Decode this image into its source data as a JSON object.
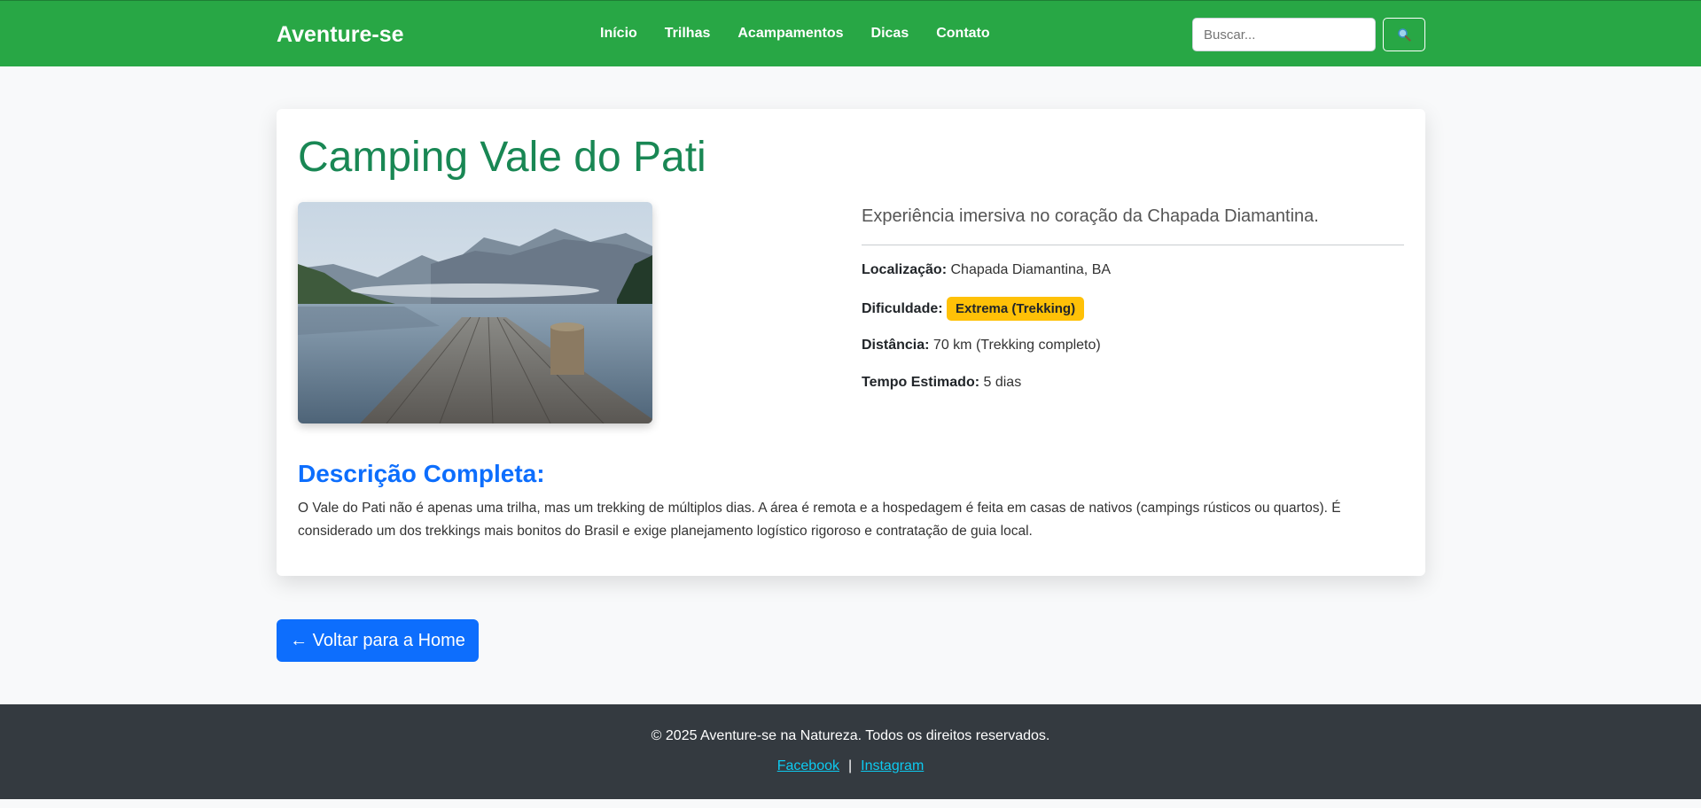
{
  "header": {
    "brand": "Aventure-se",
    "nav": [
      "Início",
      "Trilhas",
      "Acampamentos",
      "Dicas",
      "Contato"
    ],
    "search_placeholder": "Buscar...",
    "search_icon": "magnifier-icon"
  },
  "main": {
    "title": "Camping Vale do Pati",
    "subtitle": "Experiência imersiva no coração da Chapada Diamantina.",
    "location_label": "Localização:",
    "location_value": "Chapada Diamantina, BA",
    "difficulty_label": "Dificuldade:",
    "difficulty_value": "Extrema (Trekking)",
    "distance_label": "Distância:",
    "distance_value": "70 km (Trekking completo)",
    "time_label": "Tempo Estimado:",
    "time_value": "5 dias",
    "description_title": "Descrição Completa:",
    "description_text": "O Vale do Pati não é apenas uma trilha, mas um trekking de múltiplos dias. A área é remota e a hospedagem é feita em casas de nativos (campings rústicos ou quartos). É considerado um dos trekkings mais bonitos do Brasil e exige planejamento logístico rigoroso e contratação de guia local.",
    "back_button": "← Voltar para a Home"
  },
  "footer": {
    "copyright": "© 2025 Aventure-se na Natureza. Todos os direitos reservados.",
    "facebook": "Facebook",
    "separator": "|",
    "instagram": "Instagram"
  },
  "colors": {
    "navbar": "#28a745",
    "title": "#198754",
    "badge": "#ffc107",
    "primary": "#0d6efd",
    "footer": "#343a40"
  }
}
